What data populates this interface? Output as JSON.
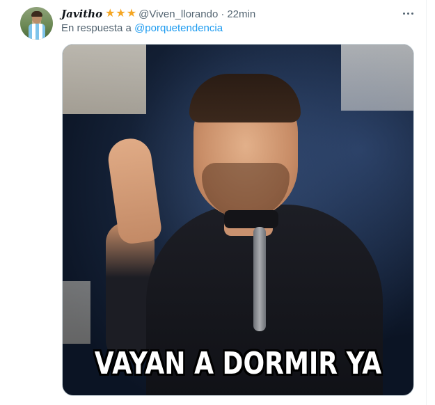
{
  "tweet": {
    "display_name": "Javitho",
    "badges": [
      "star-icon",
      "star-icon",
      "star-icon"
    ],
    "star_glyph": "★",
    "handle": "@Viven_llorando",
    "separator": "·",
    "time": "22min",
    "reply_prefix": "En respuesta a",
    "reply_to": "@porquetendencia",
    "media_caption": "VAYAN A DORMIR YA"
  },
  "colors": {
    "link": "#1d9bf0",
    "secondary_text": "#536471",
    "star": "#f5a623"
  }
}
